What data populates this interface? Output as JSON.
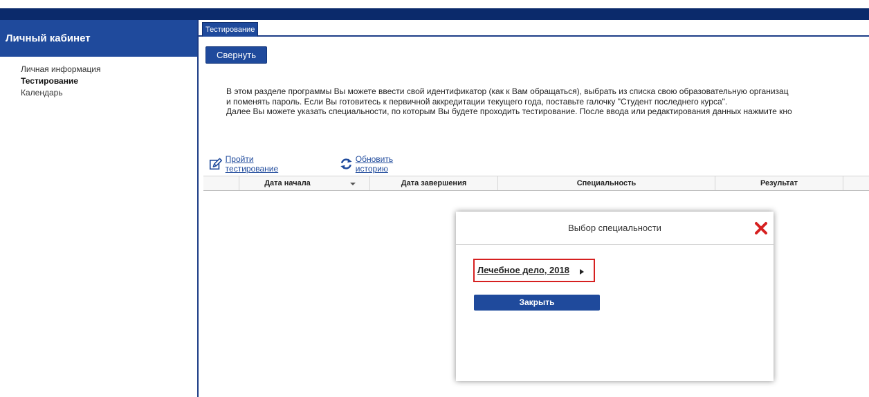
{
  "sidebar": {
    "title": "Личный кабинет",
    "items": [
      {
        "label": "Личная информация",
        "active": false
      },
      {
        "label": "Тестирование",
        "active": true
      },
      {
        "label": "Календарь",
        "active": false
      }
    ]
  },
  "main": {
    "tab_label": "Тестирование",
    "collapse_label": "Свернуть",
    "intro_lines": [
      "В этом разделе программы Вы можете ввести свой идентификатор (как к Вам обращаться), выбрать из списка свою образовательную организац",
      "и поменять пароль. Если Вы готовитесь к первичной аккредитации текущего года, поставьте галочку \"Студент последнего курса\".",
      "Далее Вы можете указать специальности, по которым Вы будете проходить тестирование. После ввода или редактирования данных нажмите кно"
    ],
    "actions": {
      "take_test": "Пройти тестирование",
      "refresh_history": "Обновить историю"
    },
    "grid": {
      "columns": [
        "Дата начала",
        "Дата завершения",
        "Специальность",
        "Результат"
      ]
    }
  },
  "modal": {
    "title": "Выбор специальности",
    "specialty": "Лечебное дело, 2018",
    "close_label": "Закрыть"
  },
  "colors": {
    "accent": "#1f4a9c",
    "topbar": "#0b2a6b",
    "highlight": "#d62020"
  }
}
